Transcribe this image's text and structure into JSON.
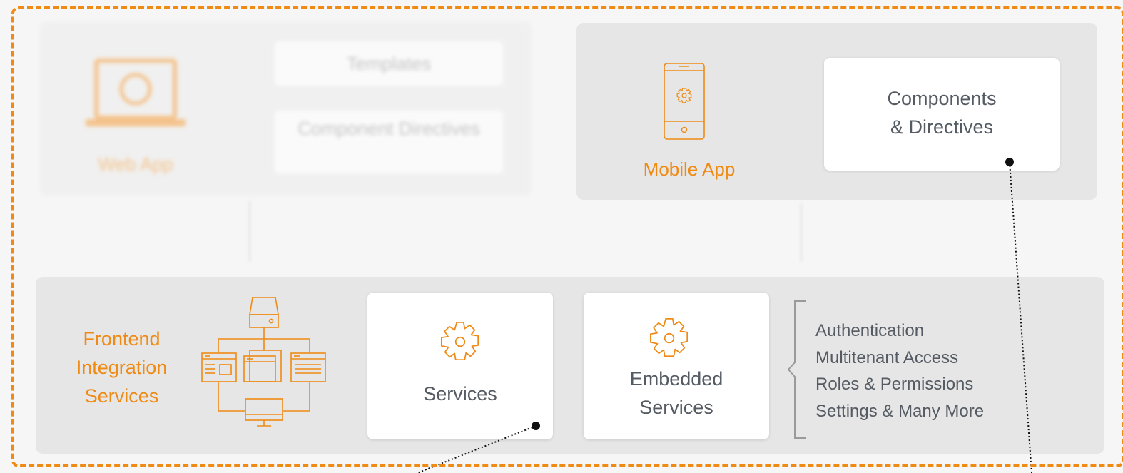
{
  "faded_section": {
    "webapp_label": "Web App",
    "cards": [
      "Templates",
      "Component Directives"
    ]
  },
  "mobile": {
    "label": "Mobile App",
    "card_line1": "Components",
    "card_line2": "& Directives"
  },
  "frontend": {
    "label_line1": "Frontend",
    "label_line2": "Integration",
    "label_line3": "Services"
  },
  "services_card": {
    "label": "Services"
  },
  "embedded_card": {
    "line1": "Embedded",
    "line2": "Services"
  },
  "features": [
    "Authentication",
    "Multitenant Access",
    "Roles & Permissions",
    "Settings & Many More"
  ],
  "colors": {
    "accent": "#ef8a14",
    "panel": "#e6e6e6",
    "text": "#555b63"
  },
  "icons": [
    "laptop-icon",
    "phone-icon",
    "network-icon",
    "gear-icon"
  ]
}
